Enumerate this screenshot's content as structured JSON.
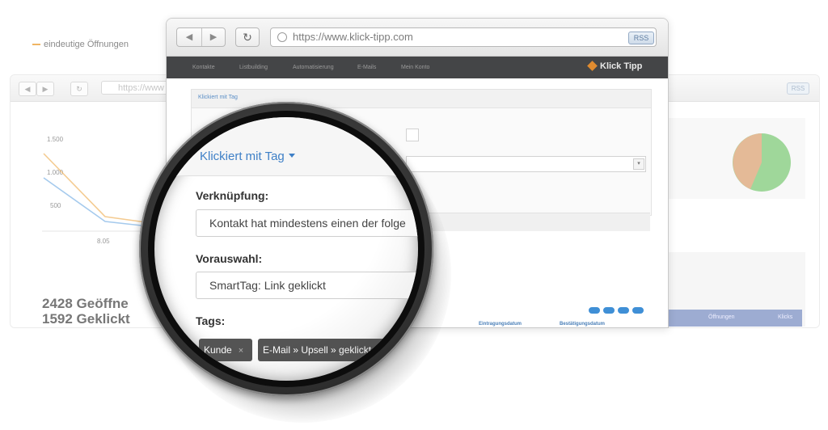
{
  "back_browser": {
    "url": "https://www",
    "rss": "RSS",
    "legend": "eindeutige Öffnungen",
    "y_ticks": [
      "1.500",
      "1.000",
      "500"
    ],
    "x_tick": "8.05",
    "stats": [
      "2428 Geöffne",
      "1592 Geklickt"
    ],
    "right_table_headers": [
      "Öffnungen",
      "Klicks"
    ]
  },
  "front_browser": {
    "url": "https://www.klick-tipp.com",
    "rss": "RSS",
    "nav_back_icon": "back-arrow-icon",
    "nav_forward_icon": "forward-arrow-icon",
    "reload_icon": "reload-icon",
    "app_nav": [
      "Kontakte",
      "Listbuilding",
      "Automatisierung",
      "E-Mails",
      "Mein Konto"
    ],
    "logo": "Klick Tipp",
    "table_headers": [
      "Eintragungsdatum",
      "Bestätigungsdatum"
    ]
  },
  "lens": {
    "filter_link": "Klickiert mit Tag",
    "verknuepfung_label": "Verknüpfung:",
    "verknuepfung_value": "Kontakt hat mindestens einen der folge",
    "vorauswahl_label": "Vorauswahl:",
    "vorauswahl_value": "SmartTag: Link geklickt",
    "tags_label": "Tags:",
    "tags": [
      {
        "label": "Kunde",
        "remove": "×"
      },
      {
        "label": "E-Mail » Upsell » geklickt",
        "remove": "×"
      }
    ]
  },
  "colors": {
    "accent_blue": "#3f80c7",
    "nav_dark": "#444547",
    "tag_bg": "#555555",
    "pie_green": "#8fd18a",
    "pie_orange": "#f0b596",
    "line_orange": "#f0b563",
    "line_blue": "#7fb4e6"
  }
}
